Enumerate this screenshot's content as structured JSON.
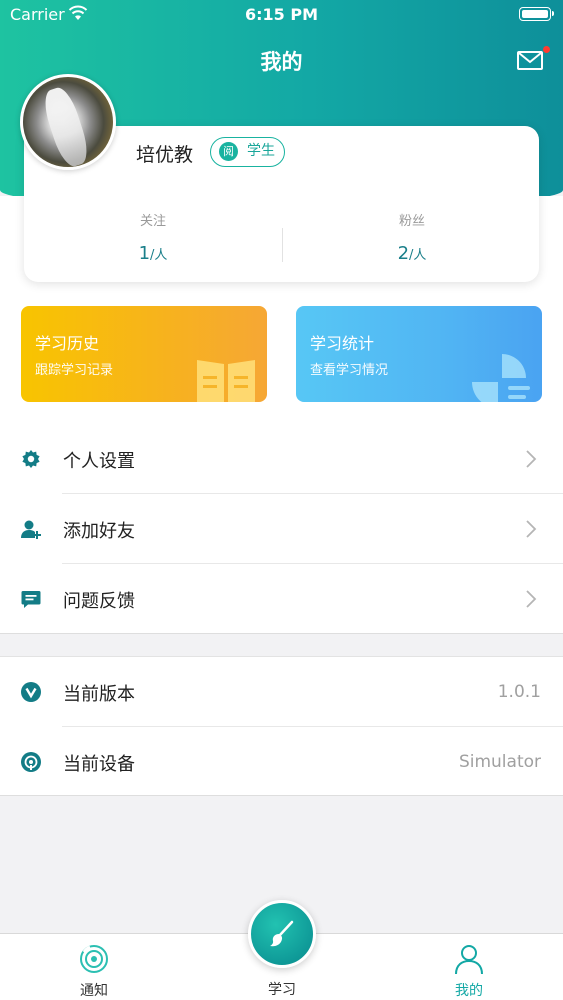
{
  "status_bar": {
    "carrier": "Carrier",
    "time": "6:15 PM"
  },
  "nav": {
    "title": "我的"
  },
  "profile": {
    "name": "培优教",
    "role_icon_text": "阅",
    "role": "学生",
    "following_label": "关注",
    "following_value": "1",
    "followers_label": "粉丝",
    "followers_value": "2",
    "unit": "/人"
  },
  "cards": {
    "history": {
      "title": "学习历史",
      "subtitle": "跟踪学习记录"
    },
    "stats": {
      "title": "学习统计",
      "subtitle": "查看学习情况"
    }
  },
  "menu": {
    "group1": [
      {
        "label": "个人设置",
        "icon": "gear-icon"
      },
      {
        "label": "添加好友",
        "icon": "add-user-icon"
      },
      {
        "label": "问题反馈",
        "icon": "feedback-icon"
      }
    ],
    "group2": [
      {
        "label": "当前版本",
        "value": "1.0.1",
        "icon": "version-icon"
      },
      {
        "label": "当前设备",
        "value": "Simulator",
        "icon": "device-icon"
      }
    ]
  },
  "tabs": [
    {
      "label": "通知",
      "icon": "notification-icon"
    },
    {
      "label": "学习",
      "icon": "brush-icon"
    },
    {
      "label": "我的",
      "icon": "profile-icon",
      "active": true
    }
  ],
  "colors": {
    "primary": "#13a8a5",
    "accent_yellow": "#f8c400",
    "accent_blue": "#51b5f3",
    "badge_red": "#ff3b30"
  }
}
